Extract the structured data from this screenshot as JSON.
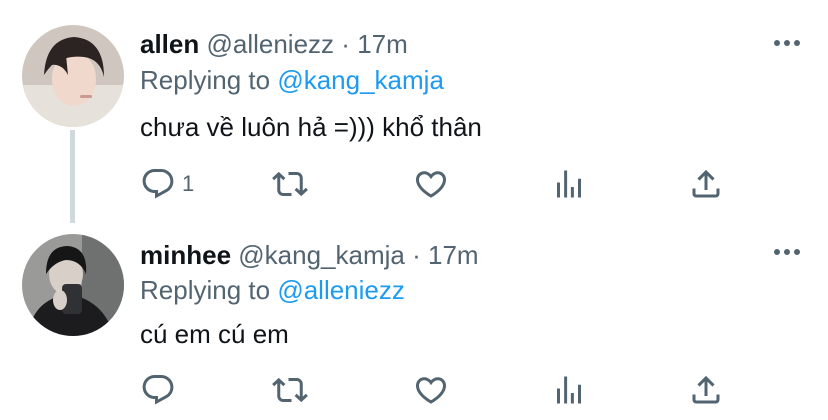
{
  "tweets": [
    {
      "name": "allen",
      "handle": "@alleniezz",
      "time": "17m",
      "reply_prefix": "Replying to",
      "reply_to": "@kang_kamja",
      "text": "chưa về luôn hả =))) khổ thân",
      "reply_count": "1",
      "retweet_count": "",
      "like_count": ""
    },
    {
      "name": "minhee",
      "handle": "@kang_kamja",
      "time": "17m",
      "reply_prefix": "Replying to",
      "reply_to": "@alleniezz",
      "text": "cú em cú em",
      "reply_count": "",
      "retweet_count": "",
      "like_count": ""
    }
  ],
  "separator": "·",
  "colors": {
    "link": "#1d9bf0",
    "secondary": "#536471",
    "thread_line": "#cfd9de"
  }
}
